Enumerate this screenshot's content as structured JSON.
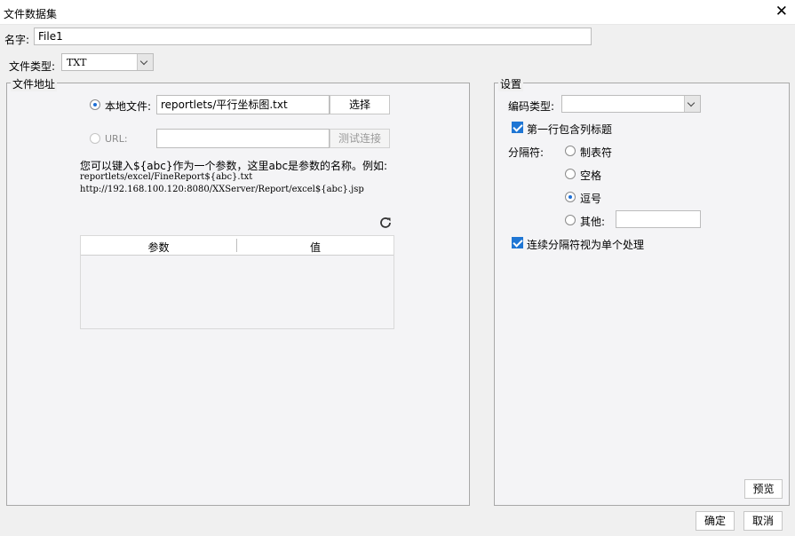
{
  "window": {
    "title": "文件数据集"
  },
  "name": {
    "label": "名字:",
    "value": "File1"
  },
  "file_type": {
    "label": "文件类型:",
    "selected": "TXT"
  },
  "file_address": {
    "legend": "文件地址",
    "local_file_label": "本地文件:",
    "local_file_value": "reportlets/平行坐标图.txt",
    "choose_button": "选择",
    "url_label": "URL:",
    "url_value": "",
    "test_connection_button": "测试连接",
    "hint_line1": "您可以键入${abc}作为一个参数，这里abc是参数的名称。例如:",
    "hint_line2": "reportlets/excel/FineReport${abc}.txt",
    "hint_line3": "http://192.168.100.120:8080/XXServer/Report/excel${abc}.jsp",
    "params_table": {
      "columns": [
        "参数",
        "值"
      ],
      "rows": []
    }
  },
  "settings": {
    "legend": "设置",
    "encoding_label": "编码类型:",
    "encoding_value": "",
    "first_row_header": "第一行包含列标题",
    "delimiter_label": "分隔符:",
    "delimiters": [
      "制表符",
      "空格",
      "逗号",
      "其他:"
    ],
    "selected_delimiter": "逗号",
    "other_value": "",
    "consecutive_delimiters": "连续分隔符视为单个处理",
    "preview_button": "预览"
  },
  "footer": {
    "ok_button": "确定",
    "cancel_button": "取消"
  },
  "colors": {
    "accent": "#1f76d4"
  }
}
